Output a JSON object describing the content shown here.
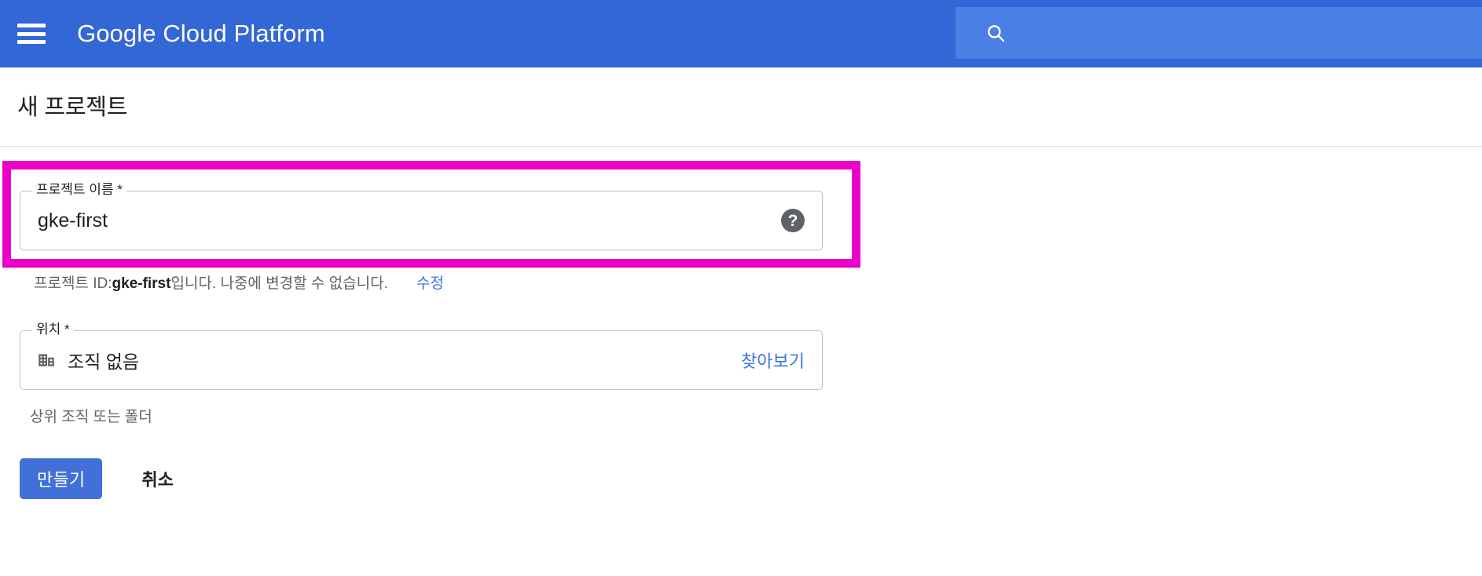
{
  "appbar": {
    "menu_icon": "hamburger-menu-icon",
    "brand": "Google Cloud Platform",
    "search": {
      "icon": "search-icon",
      "value": "",
      "placeholder": ""
    },
    "background_color": "#3367d6",
    "search_background_color": "#4a80e4"
  },
  "page": {
    "title": "새 프로젝트"
  },
  "highlight": {
    "color": "#ea00c8",
    "target": "project-name-field"
  },
  "project_name_field": {
    "label": "프로젝트 이름 *",
    "value": "gke-first",
    "placeholder": "",
    "help_icon": "help-circle-icon",
    "help_icon_glyph": "?"
  },
  "project_id_hint": {
    "prefix": "프로젝트 ID: ",
    "id": "gke-first",
    "suffix": "입니다. 나중에 변경할 수 없습니다.",
    "edit_link": "수정",
    "link_color": "#3c76e0"
  },
  "location_field": {
    "label": "위치 *",
    "icon": "domain-building-icon",
    "value": "조직 없음",
    "browse_link": "찾아보기",
    "hint": "상위 조직 또는 폴더"
  },
  "actions": {
    "create_label": "만들기",
    "cancel_label": "취소",
    "primary_color": "#4270d8"
  }
}
